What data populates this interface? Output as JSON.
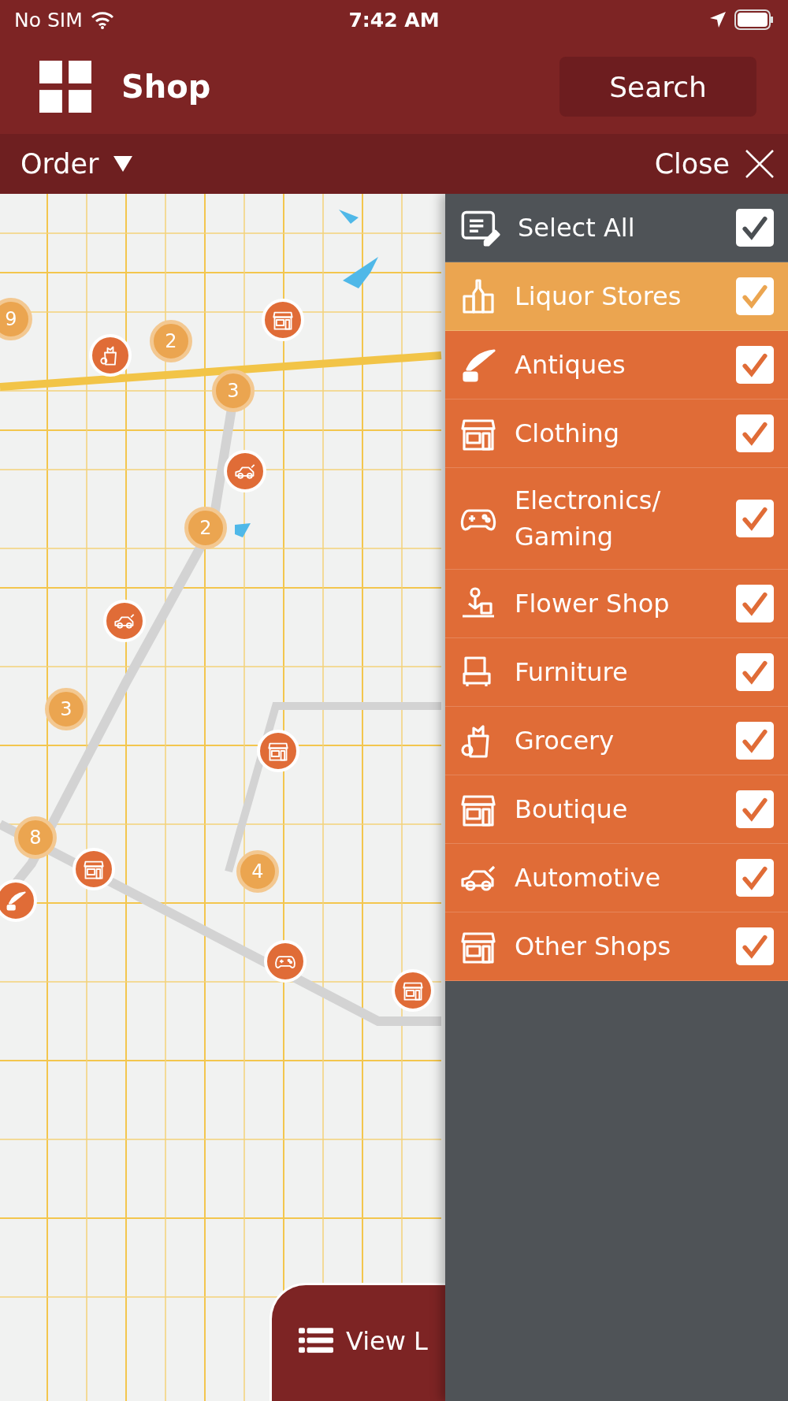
{
  "status_bar": {
    "carrier": "No SIM",
    "time": "7:42 AM"
  },
  "header": {
    "title": "Shop",
    "search_button": "Search"
  },
  "filter_bar": {
    "order": "Order",
    "close": "Close"
  },
  "map": {
    "markers": [
      {
        "kind": "cluster",
        "count": "9"
      },
      {
        "kind": "cluster",
        "count": "2"
      },
      {
        "kind": "cluster",
        "count": "3"
      },
      {
        "kind": "cluster",
        "count": "2"
      },
      {
        "kind": "cluster",
        "count": "3"
      },
      {
        "kind": "cluster",
        "count": "8"
      },
      {
        "kind": "cluster",
        "count": "4"
      },
      {
        "kind": "shop"
      },
      {
        "kind": "shop"
      },
      {
        "kind": "shop"
      },
      {
        "kind": "shop"
      },
      {
        "kind": "shop"
      },
      {
        "kind": "shop"
      },
      {
        "kind": "shop"
      },
      {
        "kind": "shop"
      },
      {
        "kind": "shop"
      }
    ],
    "view_list_button": "View L"
  },
  "filter_panel": {
    "select_all": {
      "label": "Select All",
      "checked": true
    },
    "categories": [
      {
        "label": "Liquor Stores",
        "checked": true,
        "selected": true
      },
      {
        "label": "Antiques",
        "checked": true,
        "selected": false
      },
      {
        "label": "Clothing",
        "checked": true,
        "selected": false
      },
      {
        "label": "Electronics/ Gaming",
        "checked": true,
        "selected": false
      },
      {
        "label": "Flower Shop",
        "checked": true,
        "selected": false
      },
      {
        "label": "Furniture",
        "checked": true,
        "selected": false
      },
      {
        "label": "Grocery",
        "checked": true,
        "selected": false
      },
      {
        "label": "Boutique",
        "checked": true,
        "selected": false
      },
      {
        "label": "Automotive",
        "checked": true,
        "selected": false
      },
      {
        "label": "Other Shops",
        "checked": true,
        "selected": false
      }
    ]
  }
}
